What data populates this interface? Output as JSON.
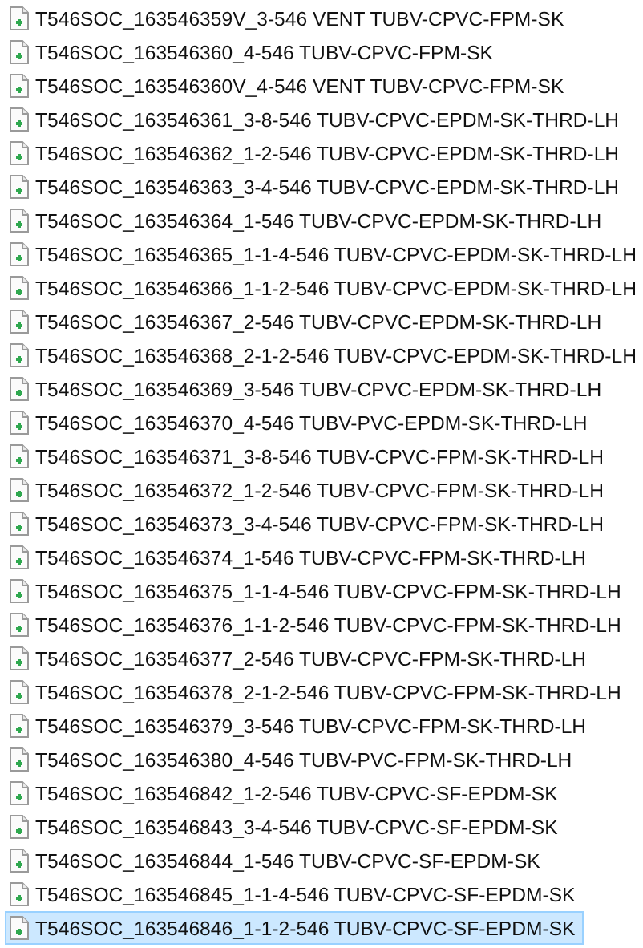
{
  "files": [
    {
      "name": "T546SOC_163546359V_3-546 VENT TUBV-CPVC-FPM-SK",
      "selected": false
    },
    {
      "name": "T546SOC_163546360_4-546 TUBV-CPVC-FPM-SK",
      "selected": false
    },
    {
      "name": "T546SOC_163546360V_4-546 VENT TUBV-CPVC-FPM-SK",
      "selected": false
    },
    {
      "name": "T546SOC_163546361_3-8-546 TUBV-CPVC-EPDM-SK-THRD-LH",
      "selected": false
    },
    {
      "name": "T546SOC_163546362_1-2-546 TUBV-CPVC-EPDM-SK-THRD-LH",
      "selected": false
    },
    {
      "name": "T546SOC_163546363_3-4-546 TUBV-CPVC-EPDM-SK-THRD-LH",
      "selected": false
    },
    {
      "name": "T546SOC_163546364_1-546 TUBV-CPVC-EPDM-SK-THRD-LH",
      "selected": false
    },
    {
      "name": "T546SOC_163546365_1-1-4-546 TUBV-CPVC-EPDM-SK-THRD-LH",
      "selected": false
    },
    {
      "name": "T546SOC_163546366_1-1-2-546 TUBV-CPVC-EPDM-SK-THRD-LH",
      "selected": false
    },
    {
      "name": "T546SOC_163546367_2-546 TUBV-CPVC-EPDM-SK-THRD-LH",
      "selected": false
    },
    {
      "name": "T546SOC_163546368_2-1-2-546 TUBV-CPVC-EPDM-SK-THRD-LH",
      "selected": false
    },
    {
      "name": "T546SOC_163546369_3-546 TUBV-CPVC-EPDM-SK-THRD-LH",
      "selected": false
    },
    {
      "name": "T546SOC_163546370_4-546 TUBV-PVC-EPDM-SK-THRD-LH",
      "selected": false
    },
    {
      "name": "T546SOC_163546371_3-8-546 TUBV-CPVC-FPM-SK-THRD-LH",
      "selected": false
    },
    {
      "name": "T546SOC_163546372_1-2-546 TUBV-CPVC-FPM-SK-THRD-LH",
      "selected": false
    },
    {
      "name": "T546SOC_163546373_3-4-546 TUBV-CPVC-FPM-SK-THRD-LH",
      "selected": false
    },
    {
      "name": "T546SOC_163546374_1-546 TUBV-CPVC-FPM-SK-THRD-LH",
      "selected": false
    },
    {
      "name": "T546SOC_163546375_1-1-4-546 TUBV-CPVC-FPM-SK-THRD-LH",
      "selected": false
    },
    {
      "name": "T546SOC_163546376_1-1-2-546 TUBV-CPVC-FPM-SK-THRD-LH",
      "selected": false
    },
    {
      "name": "T546SOC_163546377_2-546 TUBV-CPVC-FPM-SK-THRD-LH",
      "selected": false
    },
    {
      "name": "T546SOC_163546378_2-1-2-546 TUBV-CPVC-FPM-SK-THRD-LH",
      "selected": false
    },
    {
      "name": "T546SOC_163546379_3-546 TUBV-CPVC-FPM-SK-THRD-LH",
      "selected": false
    },
    {
      "name": "T546SOC_163546380_4-546 TUBV-PVC-FPM-SK-THRD-LH",
      "selected": false
    },
    {
      "name": "T546SOC_163546842_1-2-546 TUBV-CPVC-SF-EPDM-SK",
      "selected": false
    },
    {
      "name": "T546SOC_163546843_3-4-546 TUBV-CPVC-SF-EPDM-SK",
      "selected": false
    },
    {
      "name": "T546SOC_163546844_1-546 TUBV-CPVC-SF-EPDM-SK",
      "selected": false
    },
    {
      "name": "T546SOC_163546845_1-1-4-546 TUBV-CPVC-SF-EPDM-SK",
      "selected": false
    },
    {
      "name": "T546SOC_163546846_1-1-2-546 TUBV-CPVC-SF-EPDM-SK",
      "selected": true
    }
  ]
}
